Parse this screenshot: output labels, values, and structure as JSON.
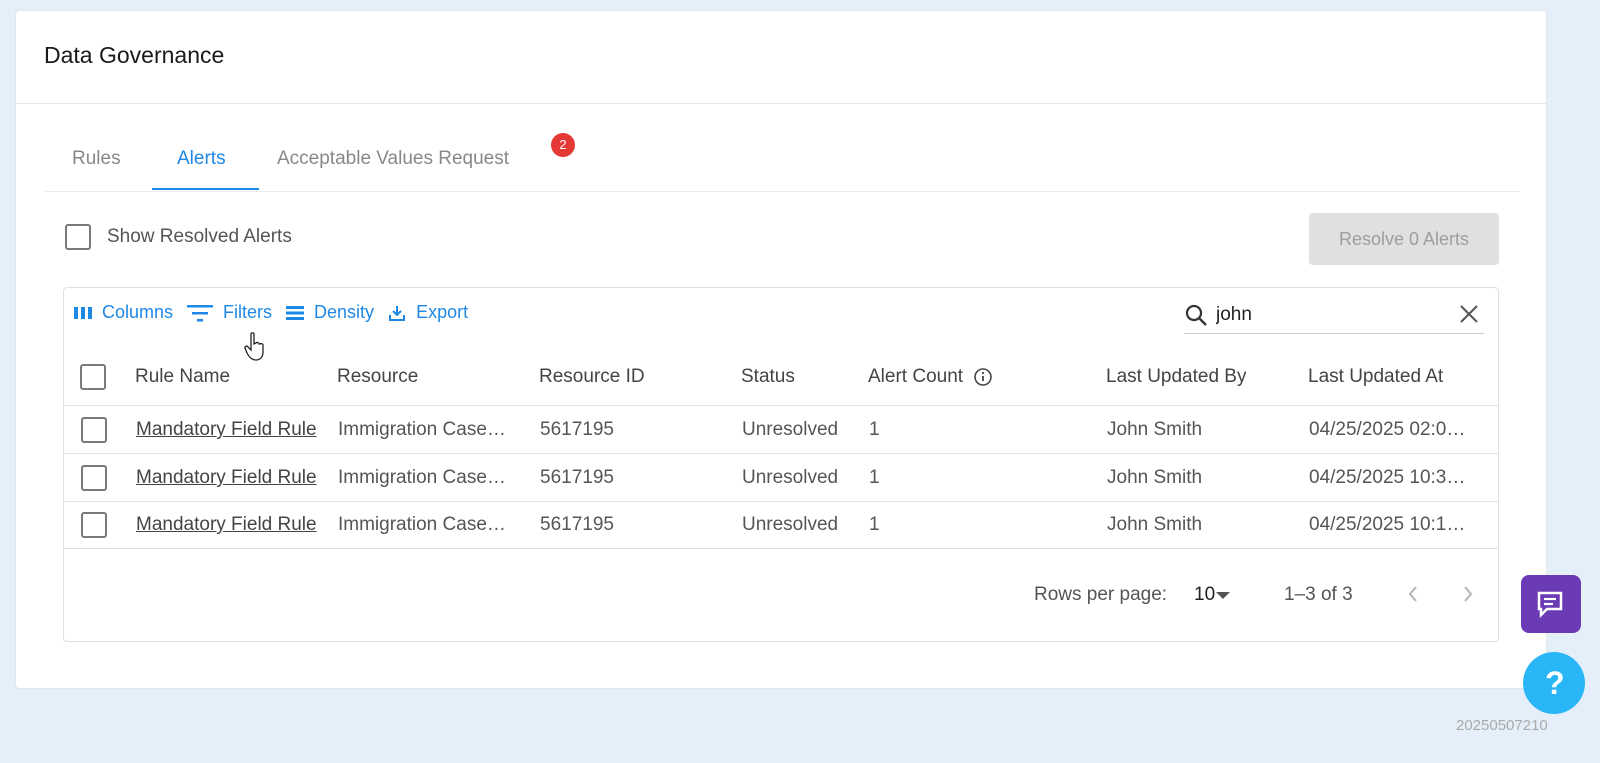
{
  "page": {
    "title": "Data Governance"
  },
  "tabs": [
    {
      "label": "Rules",
      "active": false
    },
    {
      "label": "Alerts",
      "active": true
    },
    {
      "label": "Acceptable Values Request",
      "active": false,
      "badge": "2"
    }
  ],
  "controls": {
    "show_resolved_label": "Show Resolved Alerts",
    "show_resolved_checked": false,
    "resolve_button": "Resolve 0 Alerts"
  },
  "toolbar": {
    "columns": "Columns",
    "filters": "Filters",
    "density": "Density",
    "export": "Export",
    "search_value": "john"
  },
  "table": {
    "headers": {
      "rule_name": "Rule Name",
      "resource": "Resource",
      "resource_id": "Resource ID",
      "status": "Status",
      "alert_count": "Alert Count",
      "last_updated_by": "Last Updated By",
      "last_updated_at": "Last Updated At"
    },
    "rows": [
      {
        "rule_name": "Mandatory Field Rule",
        "resource": "Immigration Case…",
        "resource_id": "5617195",
        "status": "Unresolved",
        "alert_count": "1",
        "last_updated_by": "John Smith",
        "last_updated_at": "04/25/2025 02:0…"
      },
      {
        "rule_name": "Mandatory Field Rule",
        "resource": "Immigration Case…",
        "resource_id": "5617195",
        "status": "Unresolved",
        "alert_count": "1",
        "last_updated_by": "John Smith",
        "last_updated_at": "04/25/2025 10:3…"
      },
      {
        "rule_name": "Mandatory Field Rule",
        "resource": "Immigration Case…",
        "resource_id": "5617195",
        "status": "Unresolved",
        "alert_count": "1",
        "last_updated_by": "John Smith",
        "last_updated_at": "04/25/2025 10:1…"
      }
    ]
  },
  "pagination": {
    "rows_per_page_label": "Rows per page:",
    "rows_per_page": "10",
    "range": "1–3 of 3"
  },
  "footer": {
    "build": "20250507210"
  },
  "colors": {
    "accent": "#1e88e5",
    "badge": "#e53935",
    "chat": "#6a3bb5",
    "help": "#29b6f6"
  }
}
